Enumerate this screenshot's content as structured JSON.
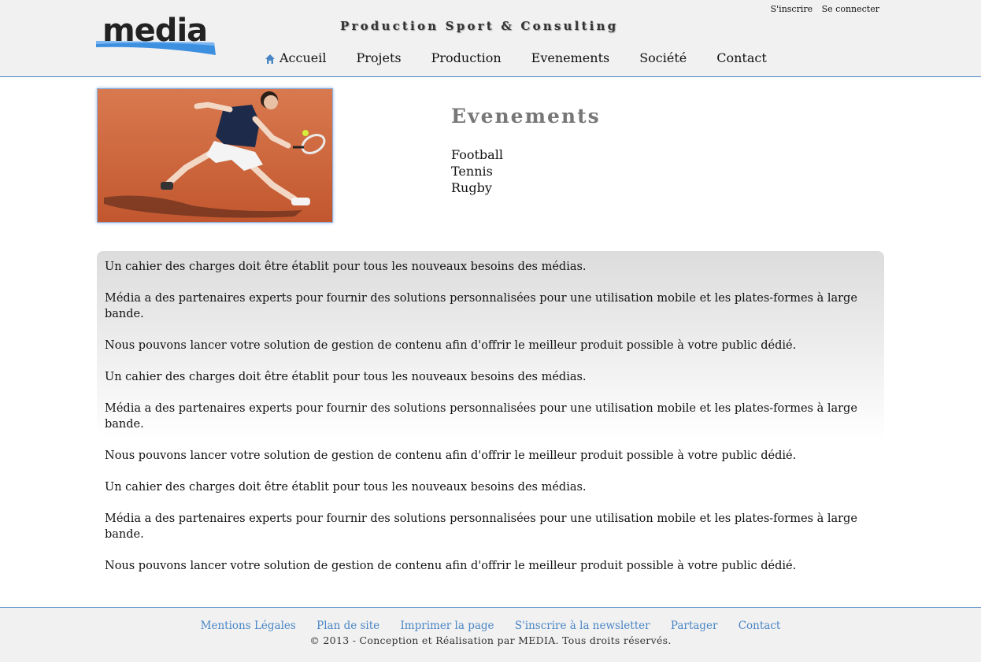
{
  "brand": {
    "logo_text": "media",
    "tagline": "Production Sport & Consulting"
  },
  "auth": {
    "signup": "S'inscrire",
    "login": "Se connecter"
  },
  "nav": [
    {
      "label": "Accueil",
      "icon": "home-icon"
    },
    {
      "label": "Projets"
    },
    {
      "label": "Production"
    },
    {
      "label": "Evenements"
    },
    {
      "label": "Société"
    },
    {
      "label": "Contact"
    }
  ],
  "section": {
    "title": "Evenements",
    "items": [
      "Football",
      "Tennis",
      "Rugby"
    ]
  },
  "content": {
    "paragraphs": [
      "Un cahier des charges doit être établit pour tous les nouveaux besoins des médias.",
      "Média a des partenaires experts pour fournir des solutions personnalisées pour une utilisation mobile et les plates-formes à large bande.",
      "Nous pouvons lancer votre solution de gestion de contenu afin d'offrir le meilleur produit possible à votre public dédié.",
      "Un cahier des charges doit être établit pour tous les nouveaux besoins des médias.",
      "Média a des partenaires experts pour fournir des solutions personnalisées pour une utilisation mobile et les plates-formes à large bande.",
      "Nous pouvons lancer votre solution de gestion de contenu afin d'offrir le meilleur produit possible à votre public dédié.",
      "Un cahier des charges doit être établit pour tous les nouveaux besoins des médias.",
      "Média a des partenaires experts pour fournir des solutions personnalisées pour une utilisation mobile et les plates-formes à large bande.",
      "Nous pouvons lancer votre solution de gestion de contenu afin d'offrir le meilleur produit possible à votre public dédié."
    ]
  },
  "footer": {
    "links": [
      "Mentions Légales",
      "Plan de site",
      "Imprimer la page",
      "S'inscrire à la newsletter",
      "Partager",
      "Contact"
    ],
    "copyright": "© 2013 - Conception et Réalisation par MEDIA. Tous droits réservés."
  },
  "colors": {
    "accent": "#4a86c5",
    "header_bg": "#f1f1f1",
    "title_gray": "#777777",
    "clay": "#c8633a"
  }
}
